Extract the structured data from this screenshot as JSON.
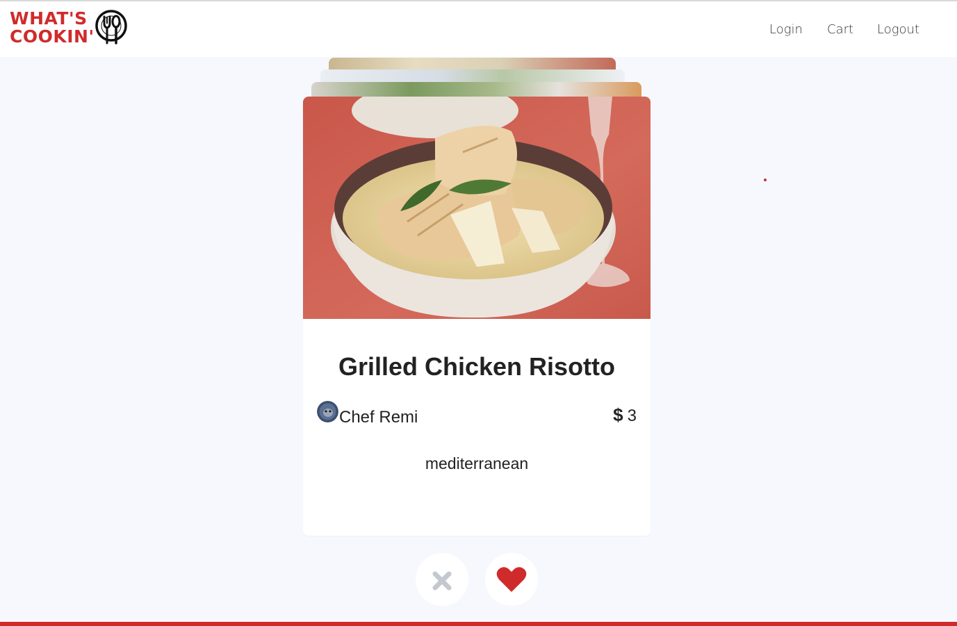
{
  "brand": {
    "logo_line1": "WHAT'S",
    "logo_line2": "COOKIN'",
    "color": "#d02b2b"
  },
  "nav": {
    "links": [
      {
        "label": "Login"
      },
      {
        "label": "Cart"
      },
      {
        "label": "Logout"
      }
    ]
  },
  "card": {
    "title": "Grilled Chicken Risotto",
    "chef_name": "Chef Remi",
    "price_symbol": "$",
    "price_value": "3",
    "cuisine": "mediterranean",
    "image_icon": "risotto-bowl-photo"
  },
  "actions": {
    "dislike_icon": "close-icon",
    "like_icon": "heart-icon",
    "dislike_color": "#c4c9cf",
    "like_color": "#d02b2b"
  },
  "theme": {
    "background": "#f7f8fd",
    "accent": "#d02b2b"
  }
}
